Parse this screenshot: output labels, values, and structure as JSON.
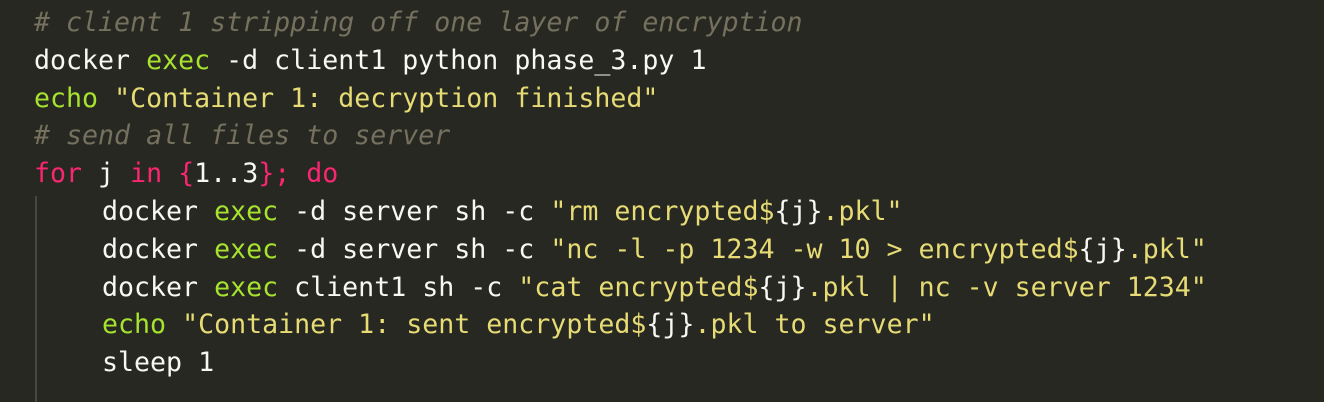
{
  "theme": {
    "background": "#272822",
    "plain": "#f8f8f2",
    "comment": "#75715e",
    "builtin": "#a6e22e",
    "string": "#e6db74",
    "keyword": "#f92672"
  },
  "lines": [
    {
      "indent": false,
      "tokens": [
        {
          "t": "# client 1 stripping off one layer of encryption",
          "k": "comment"
        }
      ]
    },
    {
      "indent": false,
      "tokens": [
        {
          "t": "docker ",
          "k": "plain"
        },
        {
          "t": "exec",
          "k": "builtin"
        },
        {
          "t": " -d client1 python phase_3.py 1",
          "k": "plain"
        }
      ]
    },
    {
      "indent": false,
      "tokens": [
        {
          "t": "echo",
          "k": "builtin"
        },
        {
          "t": " ",
          "k": "plain"
        },
        {
          "t": "\"Container 1: decryption finished\"",
          "k": "string"
        }
      ]
    },
    {
      "indent": false,
      "tokens": [
        {
          "t": "# send all files to server",
          "k": "comment"
        }
      ]
    },
    {
      "indent": false,
      "tokens": [
        {
          "t": "for",
          "k": "keyword"
        },
        {
          "t": " j ",
          "k": "plain"
        },
        {
          "t": "in",
          "k": "keyword"
        },
        {
          "t": " ",
          "k": "plain"
        },
        {
          "t": "{",
          "k": "keyword"
        },
        {
          "t": "1..3",
          "k": "plain"
        },
        {
          "t": "}",
          "k": "keyword"
        },
        {
          "t": "; ",
          "k": "keyword"
        },
        {
          "t": "do",
          "k": "keyword"
        }
      ]
    },
    {
      "indent": true,
      "tokens": [
        {
          "t": "docker ",
          "k": "plain"
        },
        {
          "t": "exec",
          "k": "builtin"
        },
        {
          "t": " -d server sh -c ",
          "k": "plain"
        },
        {
          "t": "\"rm encrypted$",
          "k": "string"
        },
        {
          "t": "{j}",
          "k": "plain"
        },
        {
          "t": ".pkl\"",
          "k": "string"
        }
      ]
    },
    {
      "indent": true,
      "tokens": [
        {
          "t": "docker ",
          "k": "plain"
        },
        {
          "t": "exec",
          "k": "builtin"
        },
        {
          "t": " -d server sh -c ",
          "k": "plain"
        },
        {
          "t": "\"nc -l -p 1234 -w 10 > encrypted$",
          "k": "string"
        },
        {
          "t": "{j}",
          "k": "plain"
        },
        {
          "t": ".pkl\"",
          "k": "string"
        }
      ]
    },
    {
      "indent": true,
      "tokens": [
        {
          "t": "docker ",
          "k": "plain"
        },
        {
          "t": "exec",
          "k": "builtin"
        },
        {
          "t": " client1 sh -c ",
          "k": "plain"
        },
        {
          "t": "\"cat encrypted$",
          "k": "string"
        },
        {
          "t": "{j}",
          "k": "plain"
        },
        {
          "t": ".pkl | nc -v server 1234\"",
          "k": "string"
        }
      ]
    },
    {
      "indent": true,
      "tokens": [
        {
          "t": "echo",
          "k": "builtin"
        },
        {
          "t": " ",
          "k": "plain"
        },
        {
          "t": "\"Container 1: sent encrypted$",
          "k": "string"
        },
        {
          "t": "{j}",
          "k": "plain"
        },
        {
          "t": ".pkl to server\"",
          "k": "string"
        }
      ]
    },
    {
      "indent": true,
      "tokens": [
        {
          "t": "sleep 1",
          "k": "plain"
        }
      ]
    }
  ]
}
